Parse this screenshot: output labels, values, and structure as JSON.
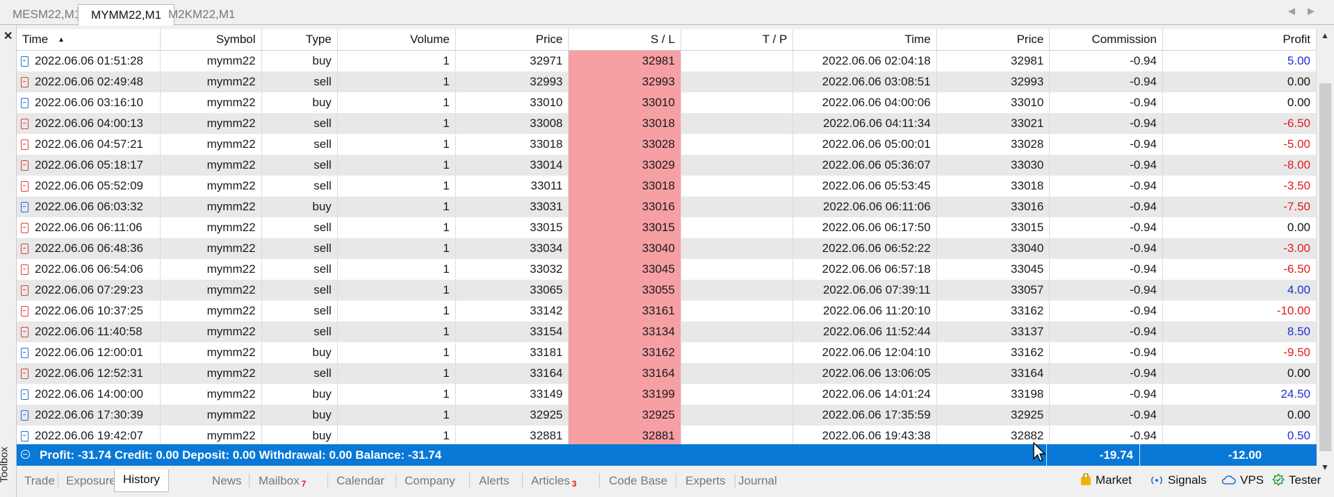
{
  "chart_tabs": [
    "MESM22,M1",
    "MYMM22,M1",
    "M2KM22,M1"
  ],
  "active_chart_tab": "MYMM22,M1",
  "toolbox_label": "Toolbox",
  "columns": {
    "time": "Time",
    "symbol": "Symbol",
    "type": "Type",
    "volume": "Volume",
    "price": "Price",
    "sl": "S / L",
    "tp": "T / P",
    "close_time": "Time",
    "close_price": "Price",
    "commission": "Commission",
    "profit": "Profit"
  },
  "rows": [
    {
      "time": "2022.06.06 01:51:28",
      "symbol": "mymm22",
      "type": "buy",
      "volume": "1",
      "price": "32971",
      "sl": "32981",
      "tp": "",
      "close_time": "2022.06.06 02:04:18",
      "close_price": "32981",
      "commission": "-0.94",
      "profit": "5.00"
    },
    {
      "time": "2022.06.06 02:49:48",
      "symbol": "mymm22",
      "type": "sell",
      "volume": "1",
      "price": "32993",
      "sl": "32993",
      "tp": "",
      "close_time": "2022.06.06 03:08:51",
      "close_price": "32993",
      "commission": "-0.94",
      "profit": "0.00"
    },
    {
      "time": "2022.06.06 03:16:10",
      "symbol": "mymm22",
      "type": "buy",
      "volume": "1",
      "price": "33010",
      "sl": "33010",
      "tp": "",
      "close_time": "2022.06.06 04:00:06",
      "close_price": "33010",
      "commission": "-0.94",
      "profit": "0.00"
    },
    {
      "time": "2022.06.06 04:00:13",
      "symbol": "mymm22",
      "type": "sell",
      "volume": "1",
      "price": "33008",
      "sl": "33018",
      "tp": "",
      "close_time": "2022.06.06 04:11:34",
      "close_price": "33021",
      "commission": "-0.94",
      "profit": "-6.50"
    },
    {
      "time": "2022.06.06 04:57:21",
      "symbol": "mymm22",
      "type": "sell",
      "volume": "1",
      "price": "33018",
      "sl": "33028",
      "tp": "",
      "close_time": "2022.06.06 05:00:01",
      "close_price": "33028",
      "commission": "-0.94",
      "profit": "-5.00"
    },
    {
      "time": "2022.06.06 05:18:17",
      "symbol": "mymm22",
      "type": "sell",
      "volume": "1",
      "price": "33014",
      "sl": "33029",
      "tp": "",
      "close_time": "2022.06.06 05:36:07",
      "close_price": "33030",
      "commission": "-0.94",
      "profit": "-8.00"
    },
    {
      "time": "2022.06.06 05:52:09",
      "symbol": "mymm22",
      "type": "sell",
      "volume": "1",
      "price": "33011",
      "sl": "33018",
      "tp": "",
      "close_time": "2022.06.06 05:53:45",
      "close_price": "33018",
      "commission": "-0.94",
      "profit": "-3.50"
    },
    {
      "time": "2022.06.06 06:03:32",
      "symbol": "mymm22",
      "type": "buy",
      "volume": "1",
      "price": "33031",
      "sl": "33016",
      "tp": "",
      "close_time": "2022.06.06 06:11:06",
      "close_price": "33016",
      "commission": "-0.94",
      "profit": "-7.50"
    },
    {
      "time": "2022.06.06 06:11:06",
      "symbol": "mymm22",
      "type": "sell",
      "volume": "1",
      "price": "33015",
      "sl": "33015",
      "tp": "",
      "close_time": "2022.06.06 06:17:50",
      "close_price": "33015",
      "commission": "-0.94",
      "profit": "0.00"
    },
    {
      "time": "2022.06.06 06:48:36",
      "symbol": "mymm22",
      "type": "sell",
      "volume": "1",
      "price": "33034",
      "sl": "33040",
      "tp": "",
      "close_time": "2022.06.06 06:52:22",
      "close_price": "33040",
      "commission": "-0.94",
      "profit": "-3.00"
    },
    {
      "time": "2022.06.06 06:54:06",
      "symbol": "mymm22",
      "type": "sell",
      "volume": "1",
      "price": "33032",
      "sl": "33045",
      "tp": "",
      "close_time": "2022.06.06 06:57:18",
      "close_price": "33045",
      "commission": "-0.94",
      "profit": "-6.50"
    },
    {
      "time": "2022.06.06 07:29:23",
      "symbol": "mymm22",
      "type": "sell",
      "volume": "1",
      "price": "33065",
      "sl": "33055",
      "tp": "",
      "close_time": "2022.06.06 07:39:11",
      "close_price": "33057",
      "commission": "-0.94",
      "profit": "4.00"
    },
    {
      "time": "2022.06.06 10:37:25",
      "symbol": "mymm22",
      "type": "sell",
      "volume": "1",
      "price": "33142",
      "sl": "33161",
      "tp": "",
      "close_time": "2022.06.06 11:20:10",
      "close_price": "33162",
      "commission": "-0.94",
      "profit": "-10.00"
    },
    {
      "time": "2022.06.06 11:40:58",
      "symbol": "mymm22",
      "type": "sell",
      "volume": "1",
      "price": "33154",
      "sl": "33134",
      "tp": "",
      "close_time": "2022.06.06 11:52:44",
      "close_price": "33137",
      "commission": "-0.94",
      "profit": "8.50"
    },
    {
      "time": "2022.06.06 12:00:01",
      "symbol": "mymm22",
      "type": "buy",
      "volume": "1",
      "price": "33181",
      "sl": "33162",
      "tp": "",
      "close_time": "2022.06.06 12:04:10",
      "close_price": "33162",
      "commission": "-0.94",
      "profit": "-9.50"
    },
    {
      "time": "2022.06.06 12:52:31",
      "symbol": "mymm22",
      "type": "sell",
      "volume": "1",
      "price": "33164",
      "sl": "33164",
      "tp": "",
      "close_time": "2022.06.06 13:06:05",
      "close_price": "33164",
      "commission": "-0.94",
      "profit": "0.00"
    },
    {
      "time": "2022.06.06 14:00:00",
      "symbol": "mymm22",
      "type": "buy",
      "volume": "1",
      "price": "33149",
      "sl": "33199",
      "tp": "",
      "close_time": "2022.06.06 14:01:24",
      "close_price": "33198",
      "commission": "-0.94",
      "profit": "24.50"
    },
    {
      "time": "2022.06.06 17:30:39",
      "symbol": "mymm22",
      "type": "buy",
      "volume": "1",
      "price": "32925",
      "sl": "32925",
      "tp": "",
      "close_time": "2022.06.06 17:35:59",
      "close_price": "32925",
      "commission": "-0.94",
      "profit": "0.00"
    },
    {
      "time": "2022.06.06 19:42:07",
      "symbol": "mymm22",
      "type": "buy",
      "volume": "1",
      "price": "32881",
      "sl": "32881",
      "tp": "",
      "close_time": "2022.06.06 19:43:38",
      "close_price": "32882",
      "commission": "-0.94",
      "profit": "0.50"
    }
  ],
  "summary": {
    "text": "Profit: -31.74  Credit: 0.00  Deposit: 0.00  Withdrawal: 0.00  Balance: -31.74",
    "commission_total": "-19.74",
    "profit_total": "-12.00"
  },
  "bottom_tabs": [
    {
      "label": "Trade"
    },
    {
      "label": "Exposure"
    },
    {
      "label": "History",
      "active": true
    },
    {
      "label": "News"
    },
    {
      "label": "Mailbox",
      "badge": "7"
    },
    {
      "label": "Calendar"
    },
    {
      "label": "Company"
    },
    {
      "label": "Alerts"
    },
    {
      "label": "Articles",
      "badge": "3"
    },
    {
      "label": "Code Base"
    },
    {
      "label": "Experts"
    },
    {
      "label": "Journal"
    }
  ],
  "right_tools": {
    "market": "Market",
    "signals": "Signals",
    "vps": "VPS",
    "tester": "Tester"
  },
  "colors": {
    "summary_bg": "#0a78d7",
    "sl_highlight": "#f6a0a4",
    "profit_positive": "#1f2fd8",
    "profit_negative": "#e21b1b",
    "buy_icon": "#1e6fd0",
    "sell_icon": "#e23b3b"
  }
}
